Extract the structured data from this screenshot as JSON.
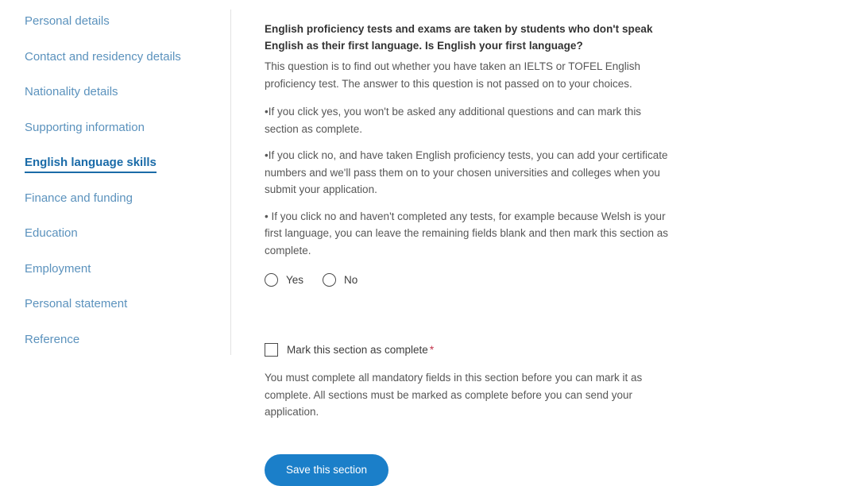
{
  "sidebar": {
    "items": [
      {
        "label": "Personal details",
        "active": false
      },
      {
        "label": "Contact and residency details",
        "active": false
      },
      {
        "label": "Nationality details",
        "active": false
      },
      {
        "label": "Supporting information",
        "active": false
      },
      {
        "label": "English language skills",
        "active": true
      },
      {
        "label": "Finance and funding",
        "active": false
      },
      {
        "label": "Education",
        "active": false
      },
      {
        "label": "Employment",
        "active": false
      },
      {
        "label": "Personal statement",
        "active": false
      },
      {
        "label": "Reference",
        "active": false
      }
    ]
  },
  "main": {
    "heading": "English proficiency tests and exams are taken by students who don't speak English as their first language. Is English your first language?",
    "intro": "This question is to find out whether you have taken an IELTS or TOFEL English proficiency test. The answer to this question is not passed on to your choices.",
    "bullets": [
      "•If you click yes, you won't be asked any additional questions and can mark this section as complete.",
      "•If you click no, and have taken English proficiency tests, you can add your certificate numbers and we'll pass them on to your chosen universities and colleges when you submit your application.",
      "• If you click no and haven't completed any tests, for example because Welsh is your first language, you can leave the remaining fields blank and then mark this section as complete."
    ],
    "radio": {
      "options": [
        {
          "label": "Yes",
          "selected": false
        },
        {
          "label": "No",
          "selected": false
        }
      ]
    },
    "complete": {
      "checkbox_label": "Mark this section as complete",
      "required_marker": "*",
      "checked": false,
      "help_text": "You must complete all mandatory fields in this section before you can mark it as complete. All sections must be marked as complete before you can send your application."
    },
    "save_button_label": "Save this section"
  },
  "colors": {
    "link": "#5b92bd",
    "link_active": "#1a6ba8",
    "button_blue": "#1b7fc9",
    "required_red": "#c2334b",
    "body_text": "#575757",
    "heading_text": "#333333",
    "divider": "#e2e2e2"
  }
}
